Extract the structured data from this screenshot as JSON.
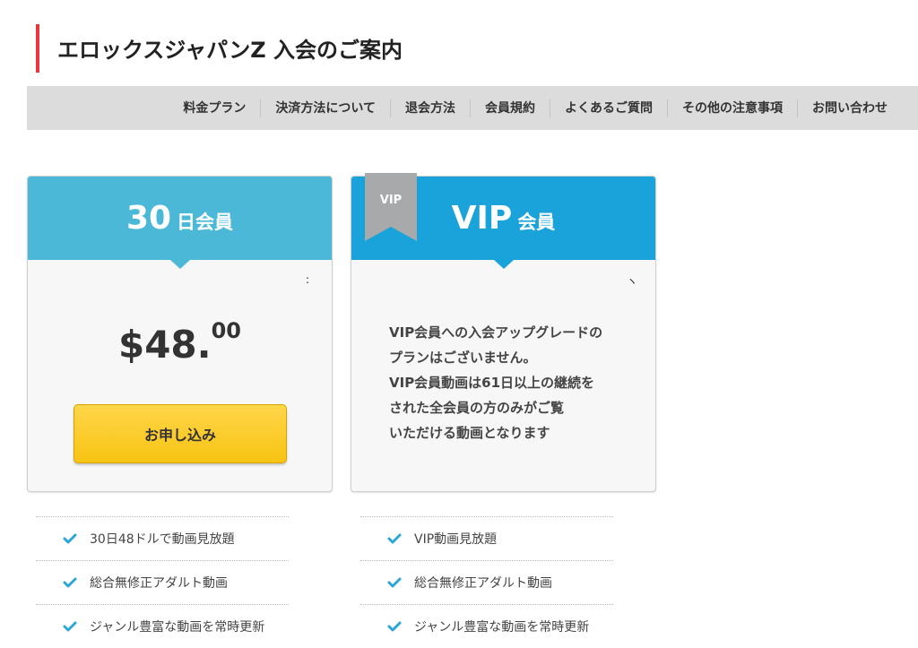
{
  "page": {
    "title": "エロックスジャパンZ 入会のご案内"
  },
  "nav": {
    "items": [
      "料金プラン",
      "決済方法について",
      "退会方法",
      "会員規約",
      "よくあるご質問",
      "その他の注意事項",
      "お問い合わせ"
    ]
  },
  "plans": {
    "basic": {
      "days": "30",
      "label": "日会員",
      "price_main": "$48.",
      "price_cents": "00",
      "button": "お申し込み",
      "stray_mark": ":",
      "features": [
        "30日48ドルで動画見放題",
        "総合無修正アダルト動画",
        "ジャンル豊富な動画を常時更新"
      ]
    },
    "vip": {
      "ribbon": "VIP",
      "name": "VIP",
      "label": "会員",
      "stray_mark": "ヽ",
      "text_lines": [
        "VIP会員への入会アップグレードの",
        "プランはございません。",
        "VIP会員動画は61日以上の継続を",
        "された全会員の方のみがご覧",
        "いただける動画となります"
      ],
      "features": [
        "VIP動画見放題",
        "総合無修正アダルト動画",
        "ジャンル豊富な動画を常時更新"
      ]
    }
  },
  "colors": {
    "accent_red": "#e8383d",
    "basic_header": "#4cb8d8",
    "vip_header": "#1aa3da",
    "button_yellow": "#f8c313",
    "check_blue": "#2aa6d8"
  }
}
